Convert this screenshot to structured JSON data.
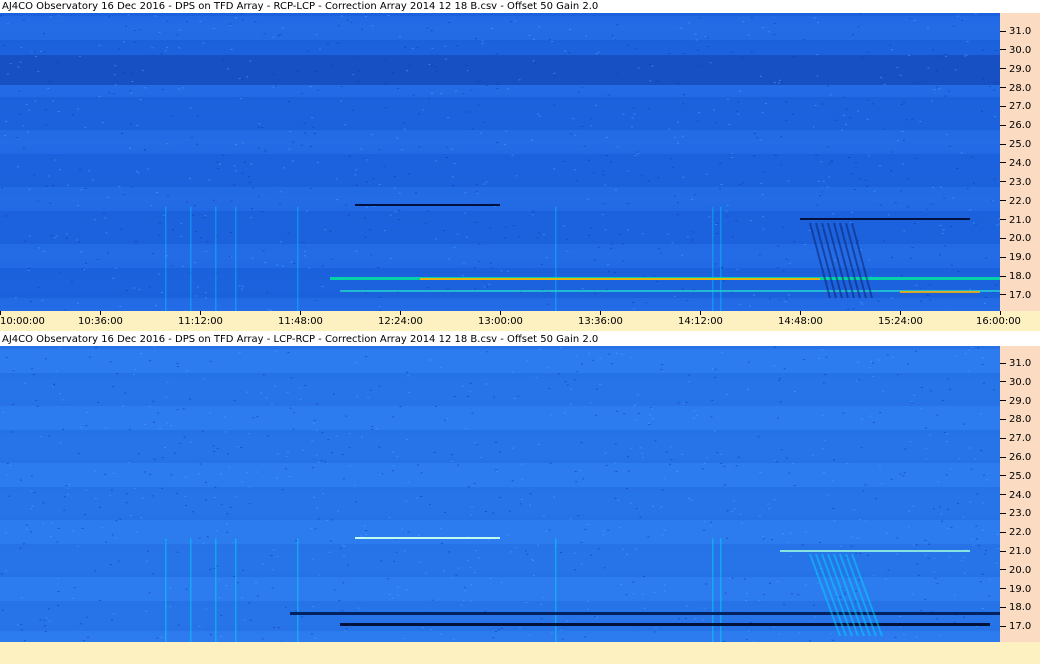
{
  "panels": [
    {
      "title": "AJ4CO Observatory 16 Dec 2016  -  DPS on TFD Array  -  RCP-LCP  -  Correction Array 2014 12 18 B.csv  -  Offset 50  Gain 2.0"
    },
    {
      "title": "AJ4CO Observatory 16 Dec 2016  -  DPS on TFD Array  -  LCP-RCP  -  Correction Array 2014 12 18 B.csv  -  Offset 50  Gain 2.0"
    }
  ],
  "chart_data": [
    {
      "type": "heatmap",
      "title": "AJ4CO Observatory 16 Dec 2016  -  DPS on TFD Array  -  RCP-LCP  -  Correction Array 2014 12 18 B.csv  -  Offset 50  Gain 2.0",
      "x_ticks": [
        "10:00:00",
        "10:36:00",
        "11:12:00",
        "11:48:00",
        "12:24:00",
        "13:00:00",
        "13:36:00",
        "14:12:00",
        "14:48:00",
        "15:24:00",
        "16:00:00"
      ],
      "y_ticks": [
        "31.0",
        "30.0",
        "29.0",
        "28.0",
        "27.0",
        "26.0",
        "25.0",
        "24.0",
        "23.0",
        "22.0",
        "21.0",
        "20.0",
        "19.0",
        "18.0",
        "17.0"
      ],
      "colors": {
        "background": "#1e64e0",
        "dark": "#0a2a8c",
        "bright": "#00c8ff",
        "hot": "#ffb000"
      }
    },
    {
      "type": "heatmap",
      "title": "AJ4CO Observatory 16 Dec 2016  -  DPS on TFD Array  -  LCP-RCP  -  Correction Array 2014 12 18 B.csv  -  Offset 50  Gain 2.0",
      "x_ticks": [],
      "y_ticks": [
        "31.0",
        "30.0",
        "29.0",
        "28.0",
        "27.0",
        "26.0",
        "25.0",
        "24.0",
        "23.0",
        "22.0",
        "21.0",
        "20.0",
        "19.0",
        "18.0",
        "17.0"
      ],
      "colors": {
        "background": "#2a78ec",
        "dark": "#0a2a8c",
        "bright": "#00e0ff",
        "hot": "#ffffff"
      }
    }
  ]
}
